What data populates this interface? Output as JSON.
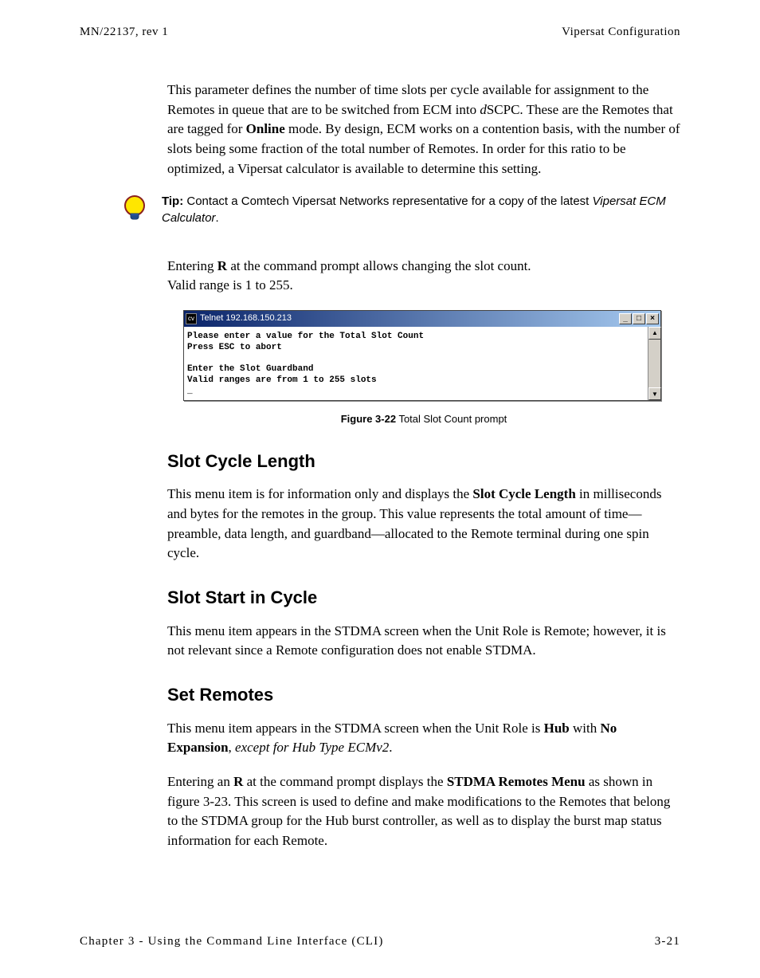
{
  "header": {
    "left": "MN/22137, rev 1",
    "right": "Vipersat Configuration"
  },
  "p1_pre": "This parameter defines the number of time slots per cycle available for assignment to the Remotes in queue that are to be switched from ECM into ",
  "p1_d": "d",
  "p1_mid1": "SCPC. These are the Remotes that are tagged for ",
  "p1_b1": "Online",
  "p1_post": " mode. By design, ECM works on a contention basis, with the number of slots being some fraction of the total number of Remotes. In order for this ratio to be optimized, a Vipersat calculator is available to determine this setting.",
  "tip": {
    "label": "Tip:",
    "text_pre": "  Contact a Comtech Vipersat Networks representative for a copy of the latest ",
    "text_em": "Vipersat ECM Calculator",
    "text_post": "."
  },
  "p2_pre": "Entering ",
  "p2_b": "R",
  "p2_post": " at the command prompt allows changing the slot count.",
  "p2_line2": "Valid range is 1 to 255.",
  "telnet": {
    "title": "Telnet 192.168.150.213",
    "body": "Please enter a value for the Total Slot Count\nPress ESC to abort\n\nEnter the Slot Guardband\nValid ranges are from 1 to 255 slots\n_"
  },
  "figcap": {
    "b": "Figure 3-22",
    "rest": "   Total Slot Count prompt"
  },
  "h_slotcycle": "Slot Cycle Length",
  "p_slotcycle_pre": "This menu item is for information only and displays the ",
  "p_slotcycle_b": "Slot Cycle Length",
  "p_slotcycle_post": " in milliseconds and bytes for the remotes in the group. This value represents the total amount of time—preamble, data length, and guardband—allocated to the Remote terminal during one spin cycle.",
  "h_slotstart": "Slot Start in Cycle",
  "p_slotstart": "This menu item appears in the STDMA screen when the Unit Role is Remote; however, it is not relevant since a Remote configuration does not enable STDMA.",
  "h_setremotes": "Set Remotes",
  "p_sr1_pre": "This menu item appears in the STDMA screen when the Unit Role is ",
  "p_sr1_b1": "Hub",
  "p_sr1_mid": " with ",
  "p_sr1_b2": "No Expansion",
  "p_sr1_comma": ", ",
  "p_sr1_i": "except for Hub Type ECMv2",
  "p_sr1_post": ".",
  "p_sr2_pre": "Entering an ",
  "p_sr2_b1": "R",
  "p_sr2_mid": " at the command prompt displays the ",
  "p_sr2_b2": "STDMA Remotes Menu",
  "p_sr2_post": " as shown in figure 3-23. This screen is used to define and make modifications to the Remotes that belong to the STDMA group for the Hub burst controller, as well as to display the burst map status information for each Remote.",
  "footer": {
    "left": "Chapter 3 - Using the Command Line Interface (CLI)",
    "right": "3-21"
  }
}
